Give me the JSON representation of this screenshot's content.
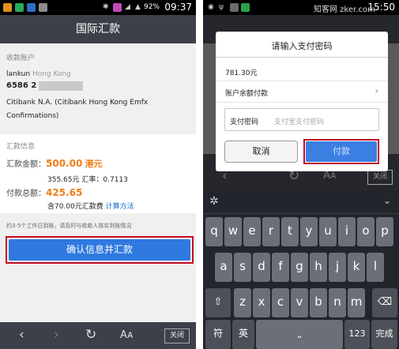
{
  "left": {
    "status": {
      "battery": "92%",
      "time": "09:37"
    },
    "title": "国际汇款",
    "recipient": {
      "section_label": "收款账户",
      "name": "lankun",
      "region": "Hong Kong",
      "account_prefix": "6586 2",
      "bank_line1": "Citibank N.A. (Citibank Hong Kong Emfx",
      "bank_line2": "Confirmations)"
    },
    "remit_info": {
      "section_label": "汇款信息",
      "amount_label": "汇款金额：",
      "amount_value": "500.00",
      "amount_currency": "港元",
      "cny_amount": "355.65元",
      "rate_text": "汇率：0.7113",
      "total_label": "付款总额：",
      "total_value": "425.65",
      "fee_text": "含70.00元汇款费",
      "fee_link": "计算方法"
    },
    "notice": "约3-5个工作日到账，请及时与收款人核实到账情况",
    "confirm_button": "确认信息并汇款",
    "bottom_close": "关闭"
  },
  "right": {
    "status": {
      "time": "15:50",
      "watermark": "知客网 zker.com"
    },
    "dialog": {
      "title": "请输入支付密码",
      "amount": "781.30元",
      "method": "账户余额付款",
      "password_label": "支付密码",
      "password_placeholder": "支付宝支付密码",
      "cancel": "取消",
      "pay": "付款"
    },
    "behind": {
      "close": "关闭"
    },
    "keyboard": {
      "row1": [
        "q",
        "w",
        "e",
        "r",
        "t",
        "y",
        "u",
        "i",
        "o",
        "p"
      ],
      "row2": [
        "a",
        "s",
        "d",
        "f",
        "g",
        "h",
        "j",
        "k",
        "l"
      ],
      "row3": [
        "z",
        "x",
        "c",
        "v",
        "b",
        "n",
        "m"
      ],
      "symbol_key": "符",
      "lang_key": "英",
      "num_key": "123",
      "done_key": "完成"
    }
  },
  "colors": {
    "accent_orange": "#f07c14",
    "link_blue": "#1e6fd0",
    "button_blue": "#2f79e0",
    "highlight_red": "#c30d23",
    "bar_dark": "#3d4049"
  }
}
